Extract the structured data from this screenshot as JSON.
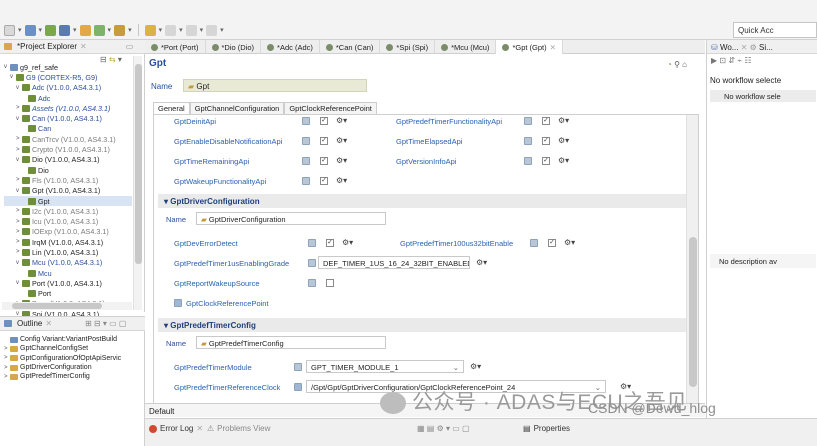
{
  "toolbar": {
    "quick_access": "Quick Acc"
  },
  "project_explorer": {
    "title": "*Project Explorer",
    "tree": [
      {
        "indent": 0,
        "twisty": "v",
        "label": "g9_ref_safe",
        "style": "normal"
      },
      {
        "indent": 1,
        "twisty": "v",
        "label": "G9 (CORTEX-R5, G9)",
        "style": "blue"
      },
      {
        "indent": 2,
        "twisty": "v",
        "label": "Adc (V1.0.0, AS4.3.1)",
        "style": "blue"
      },
      {
        "indent": 3,
        "twisty": "",
        "label": "Adc",
        "style": "blue"
      },
      {
        "indent": 2,
        "twisty": ">",
        "label": "Assets (V1.0.0, AS4.3.1)",
        "style": "italic"
      },
      {
        "indent": 2,
        "twisty": "v",
        "label": "Can (V1.0.0, AS4.3.1)",
        "style": "blue"
      },
      {
        "indent": 3,
        "twisty": "",
        "label": "Can",
        "style": "blue"
      },
      {
        "indent": 2,
        "twisty": ">",
        "label": "CanTrcv (V1.0.0, AS4.3.1)",
        "style": "gray"
      },
      {
        "indent": 2,
        "twisty": ">",
        "label": "Crypto (V1.0.0, AS4.3.1)",
        "style": "gray"
      },
      {
        "indent": 2,
        "twisty": "v",
        "label": "Dio (V1.0.0, AS4.3.1)",
        "style": "normal"
      },
      {
        "indent": 3,
        "twisty": "",
        "label": "Dio",
        "style": "normal"
      },
      {
        "indent": 2,
        "twisty": ">",
        "label": "Fls (V1.0.0, AS4.3.1)",
        "style": "gray"
      },
      {
        "indent": 2,
        "twisty": "v",
        "label": "Gpt (V1.0.0, AS4.3.1)",
        "style": "normal"
      },
      {
        "indent": 3,
        "twisty": "",
        "label": "Gpt",
        "style": "selected"
      },
      {
        "indent": 2,
        "twisty": ">",
        "label": "I2c (V1.0.0, AS4.3.1)",
        "style": "gray"
      },
      {
        "indent": 2,
        "twisty": ">",
        "label": "Icu (V1.0.0, AS4.3.1)",
        "style": "gray"
      },
      {
        "indent": 2,
        "twisty": ">",
        "label": "IOExp (V1.0.0, AS4.3.1)",
        "style": "gray"
      },
      {
        "indent": 2,
        "twisty": ">",
        "label": "IrqM (V1.0.0, AS4.3.1)",
        "style": "normal"
      },
      {
        "indent": 2,
        "twisty": ">",
        "label": "Lin (V1.0.0, AS4.3.1)",
        "style": "normal"
      },
      {
        "indent": 2,
        "twisty": "v",
        "label": "Mcu (V1.0.0, AS4.3.1)",
        "style": "blue"
      },
      {
        "indent": 3,
        "twisty": "",
        "label": "Mcu",
        "style": "blue"
      },
      {
        "indent": 2,
        "twisty": "v",
        "label": "Port (V1.0.0, AS4.3.1)",
        "style": "normal"
      },
      {
        "indent": 3,
        "twisty": "",
        "label": "Port",
        "style": "normal"
      },
      {
        "indent": 2,
        "twisty": ">",
        "label": "Pwm (V1.0.0, AS4.3.1)",
        "style": "gray"
      },
      {
        "indent": 2,
        "twisty": "v",
        "label": "Spi (V1.0.0, AS4.3.1)",
        "style": "normal"
      }
    ]
  },
  "outline": {
    "title": "Outline",
    "items": [
      {
        "twisty": "",
        "label": "Config Variant:VariantPostBuild",
        "icon": "config"
      },
      {
        "twisty": ">",
        "label": "GptChannelConfigSet",
        "icon": "folder"
      },
      {
        "twisty": ">",
        "label": "GptConfigurationOfOptApiServic",
        "icon": "folder"
      },
      {
        "twisty": ">",
        "label": "GptDriverConfiguration",
        "icon": "folder"
      },
      {
        "twisty": ">",
        "label": "GptPredefTimerConfig",
        "icon": "folder"
      }
    ]
  },
  "editor_tabs": [
    {
      "label": "*Port (Port)",
      "active": false
    },
    {
      "label": "*Dio (Dio)",
      "active": false
    },
    {
      "label": "*Adc (Adc)",
      "active": false
    },
    {
      "label": "*Can (Can)",
      "active": false
    },
    {
      "label": "*Spi (Spi)",
      "active": false
    },
    {
      "label": "*Mcu (Mcu)",
      "active": false
    },
    {
      "label": "*Gpt (Gpt)",
      "active": true
    }
  ],
  "editor": {
    "title": "Gpt",
    "name_label": "Name",
    "name_value": "Gpt",
    "subtabs": [
      "General",
      "GptChannelConfiguration",
      "GptClockReferencePoint"
    ],
    "api_params": [
      {
        "label": "GptDeinitApi",
        "col": 0,
        "row": 0
      },
      {
        "label": "GptPredefTimerFunctionalityApi",
        "col": 1,
        "row": 0
      },
      {
        "label": "GptEnableDisableNotificationApi",
        "col": 0,
        "row": 1
      },
      {
        "label": "GptTimeElapsedApi",
        "col": 1,
        "row": 1
      },
      {
        "label": "GptTimeRemainingApi",
        "col": 0,
        "row": 2
      },
      {
        "label": "GptVersionInfoApi",
        "col": 1,
        "row": 2
      },
      {
        "label": "GptWakeupFunctionalityApi",
        "col": 0,
        "row": 3
      }
    ],
    "driver_section": {
      "title": "GptDriverConfiguration",
      "name_label": "Name",
      "name_value": "GptDriverConfiguration",
      "dev_error_detect": "GptDevErrorDetect",
      "predef_100us": "GptPredefTimer100us32bitEnable",
      "predef_1us": "GptPredefTimer1usEnablingGrade",
      "predef_1us_value": "DEF_TIMER_1US_16_24_32BIT_ENABLED",
      "report_wakeup": "GptReportWakeupSource",
      "clock_ref_link": "GptClockReferencePoint"
    },
    "predef_section": {
      "title": "GptPredefTimerConfig",
      "name_label": "Name",
      "name_value": "GptPredefTimerConfig",
      "module_label": "GptPredefTimerModule",
      "module_value": "GPT_TIMER_MODULE_1",
      "clock_label": "GptPredefTimerReferenceClock",
      "clock_value": "/Gpt/Gpt/GptDriverConfiguration/GptClockReferencePoint_24"
    },
    "bottom_tab": "Default"
  },
  "right_panel": {
    "title": "Wo...",
    "title2": "Si...",
    "no_workflow": "No workflow selecte",
    "no_workflow_bar": "No workflow sele",
    "no_description": "No description av"
  },
  "status_bar": {
    "error_log": "Error Log",
    "problems": "Problems View",
    "properties": "Properties"
  },
  "watermark": {
    "main": "公众号 · ADAS与ECU之吾见",
    "sub": "CSDN @Dewd_hlog"
  }
}
